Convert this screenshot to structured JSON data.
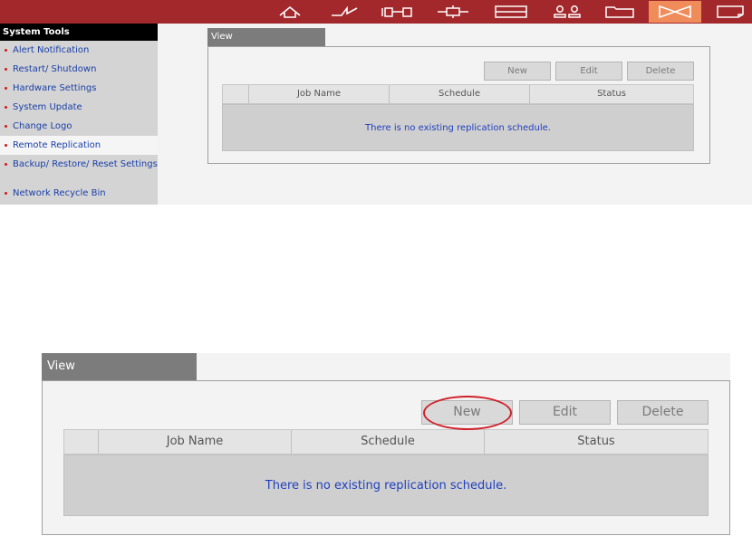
{
  "colors": {
    "topbar": "#a2282c",
    "active_nav": "#f08c5a",
    "link_blue": "#1a3fa8",
    "bullet_red": "#d21a1a",
    "highlight_red": "#d0202a"
  },
  "topnav": {
    "icons": [
      "home-icon",
      "network-icon",
      "device-icon",
      "plugin-icon",
      "storage-icon",
      "users-icon",
      "folder-icon",
      "system-tools-icon",
      "log-icon"
    ],
    "active": "system-tools-icon"
  },
  "sidebar": {
    "header": "System Tools",
    "items": [
      {
        "label": "Alert Notification"
      },
      {
        "label": "Restart/ Shutdown"
      },
      {
        "label": "Hardware Settings"
      },
      {
        "label": "System Update"
      },
      {
        "label": "Change Logo"
      },
      {
        "label": "Remote Replication",
        "active": true
      },
      {
        "label": "Backup/ Restore/ Reset Settings"
      },
      {
        "label": "Network Recycle Bin"
      }
    ]
  },
  "panel": {
    "tab": "View",
    "buttons": {
      "new": "New",
      "edit": "Edit",
      "delete": "Delete"
    },
    "columns": [
      "",
      "Job Name",
      "Schedule",
      "Status"
    ],
    "empty_message": "There is no existing replication schedule."
  }
}
